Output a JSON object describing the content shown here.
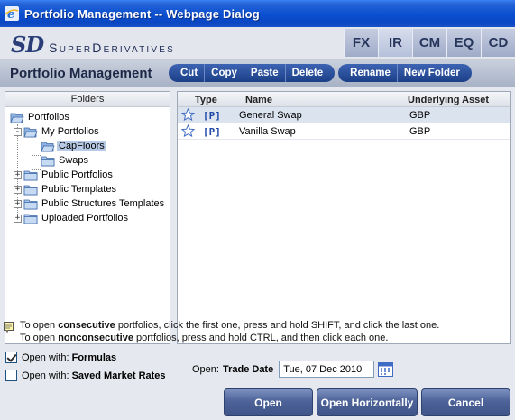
{
  "window": {
    "title": "Portfolio Management -- Webpage Dialog"
  },
  "brand": {
    "logo_mark": "SD",
    "logo_name": "SuperDerivatives"
  },
  "asset_tabs": [
    {
      "label": "FX"
    },
    {
      "label": "IR"
    },
    {
      "label": "CM"
    },
    {
      "label": "EQ"
    },
    {
      "label": "CD"
    }
  ],
  "section": {
    "title": "Portfolio Management"
  },
  "toolbar": {
    "group1": [
      "Cut",
      "Copy",
      "Paste",
      "Delete"
    ],
    "group2": [
      "Rename",
      "New Folder"
    ]
  },
  "folders": {
    "header": "Folders",
    "tree": [
      {
        "label": "Portfolios"
      },
      {
        "label": "My Portfolios"
      },
      {
        "label": "CapFloors"
      },
      {
        "label": "Swaps"
      },
      {
        "label": "Public Portfolios"
      },
      {
        "label": "Public Templates"
      },
      {
        "label": "Public Structures Templates"
      },
      {
        "label": "Uploaded Portfolios"
      }
    ]
  },
  "list": {
    "columns": {
      "type": "Type",
      "name": "Name",
      "underlying": "Underlying Asset"
    },
    "rows": [
      {
        "type": "[P]",
        "name": "General Swap",
        "underlying": "GBP"
      },
      {
        "type": "[P]",
        "name": "Vanilla Swap",
        "underlying": "GBP"
      }
    ]
  },
  "hint": {
    "line1_pre": "To open ",
    "line1_bold": "consecutive",
    "line1_post": " portfolios, click the first one, press and hold SHIFT, and click the last one.",
    "line2_pre": "To open ",
    "line2_bold": "nonconsecutive",
    "line2_post": " portfolios, press and hold CTRL, and then click each one."
  },
  "options": {
    "formulas": {
      "prefix": "Open with:",
      "label": "Formulas",
      "checked": true
    },
    "saved_rates": {
      "prefix": "Open with:",
      "label": "Saved Market Rates",
      "checked": false
    }
  },
  "open_date": {
    "prefix": "Open:",
    "label": "Trade Date",
    "value": "Tue, 07 Dec 2010"
  },
  "buttons": {
    "open": "Open",
    "open_horizontally": "Open Horizontally",
    "cancel": "Cancel"
  }
}
